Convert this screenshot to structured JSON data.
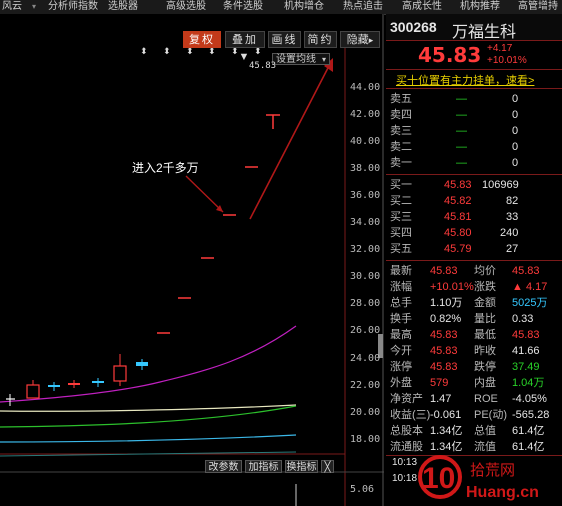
{
  "menu": [
    "风云",
    "分析师指数",
    "选股器",
    "高级选股",
    "条件选股",
    "机构增仓",
    "热点追击",
    "高成长性",
    "机构推荐",
    "高管增持"
  ],
  "toolbar": {
    "buttons": [
      "复权",
      "叠加▼",
      "画线",
      "简约",
      "隐藏"
    ],
    "ma_setting": "设置均线"
  },
  "price_axis": [
    "44.00",
    "42.00",
    "40.00",
    "38.00",
    "36.00",
    "34.00",
    "32.00",
    "30.00",
    "28.00",
    "26.00",
    "24.00",
    "22.00",
    "20.00",
    "18.00"
  ],
  "lower_axis": [
    "5.06"
  ],
  "peak_label": "45.83",
  "annotation": "进入2千多万",
  "bottom_buttons": [
    "改参数",
    "加指标",
    "换指标",
    "╳"
  ],
  "quote": {
    "code": "300268",
    "name": "万福生科",
    "price": "45.83",
    "change": "+4.17",
    "change_pct": "+10.01%",
    "banner": "买十位置有主力挂单，速看>",
    "sells": [
      {
        "label": "卖五",
        "price": "—",
        "vol": "0"
      },
      {
        "label": "卖四",
        "price": "—",
        "vol": "0"
      },
      {
        "label": "卖三",
        "price": "—",
        "vol": "0"
      },
      {
        "label": "卖二",
        "price": "—",
        "vol": "0"
      },
      {
        "label": "卖一",
        "price": "—",
        "vol": "0"
      }
    ],
    "buys": [
      {
        "label": "买一",
        "price": "45.83",
        "vol": "106969"
      },
      {
        "label": "买二",
        "price": "45.82",
        "vol": "82"
      },
      {
        "label": "买三",
        "price": "45.81",
        "vol": "33"
      },
      {
        "label": "买四",
        "price": "45.80",
        "vol": "240"
      },
      {
        "label": "买五",
        "price": "45.79",
        "vol": "27"
      }
    ],
    "stats": [
      {
        "l1": "最新",
        "v1": "45.83",
        "c1": "red",
        "l2": "均价",
        "v2": "45.83",
        "c2": "red"
      },
      {
        "l1": "涨幅",
        "v1": "+10.01%",
        "c1": "red",
        "l2": "涨跌",
        "v2": "▲ 4.17",
        "c2": "red"
      },
      {
        "l1": "总手",
        "v1": "1.10万",
        "c1": "white",
        "l2": "金额",
        "v2": "5025万",
        "c2": "cyan"
      },
      {
        "l1": "换手",
        "v1": "0.82%",
        "c1": "white",
        "l2": "量比",
        "v2": "0.33",
        "c2": "white"
      },
      {
        "l1": "最高",
        "v1": "45.83",
        "c1": "red",
        "l2": "最低",
        "v2": "45.83",
        "c2": "red"
      },
      {
        "l1": "今开",
        "v1": "45.83",
        "c1": "red",
        "l2": "昨收",
        "v2": "41.66",
        "c2": "white"
      },
      {
        "l1": "涨停",
        "v1": "45.83",
        "c1": "red",
        "l2": "跌停",
        "v2": "37.49",
        "c2": "green"
      },
      {
        "l1": "外盘",
        "v1": "579",
        "c1": "red",
        "l2": "内盘",
        "v2": "1.04万",
        "c2": "green"
      },
      {
        "l1": "净资产",
        "v1": "1.47",
        "c1": "white",
        "l2": "ROE",
        "v2": "-4.05%",
        "c2": "white"
      },
      {
        "l1": "收益(三)",
        "v1": "-0.061",
        "c1": "white",
        "l2": "PE(动)",
        "v2": "-565.28",
        "c2": "white"
      },
      {
        "l1": "总股本",
        "v1": "1.34亿",
        "c1": "white",
        "l2": "总值",
        "v2": "61.4亿",
        "c2": "white"
      },
      {
        "l1": "流通股",
        "v1": "1.34亿",
        "c1": "white",
        "l2": "流值",
        "v2": "61.4亿",
        "c2": "white"
      }
    ],
    "ticks": [
      "10:13",
      "10:18"
    ]
  },
  "watermark": {
    "num": "10",
    "brand": "拾荒网",
    "url": "Huang.cn"
  },
  "colors": {
    "up": "#ff3b3b",
    "down": "#29d329",
    "accent": "#c33a1a"
  }
}
